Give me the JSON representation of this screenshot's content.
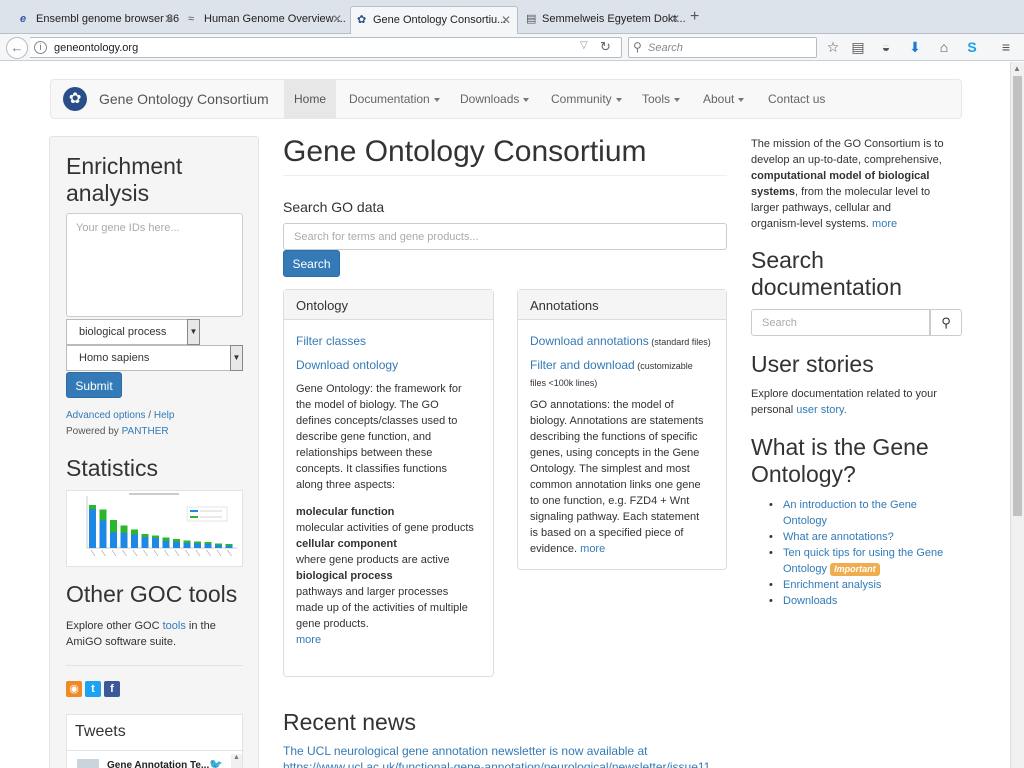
{
  "browser": {
    "tabs": [
      {
        "title": "Ensembl genome browser 86",
        "icon": "ensembl-icon"
      },
      {
        "title": "Human Genome Overview ...",
        "icon": "genome-icon"
      },
      {
        "title": "Gene Ontology Consortiu...",
        "icon": "go-icon",
        "active": true
      },
      {
        "title": "Semmelweis Egyetem Dokt...",
        "icon": "page-icon"
      }
    ],
    "url": "geneontology.org",
    "search_placeholder": "Search"
  },
  "site": {
    "brand": "Gene Ontology Consortium",
    "nav": [
      {
        "label": "Home",
        "active": true
      },
      {
        "label": "Documentation",
        "dropdown": true
      },
      {
        "label": "Downloads",
        "dropdown": true
      },
      {
        "label": "Community",
        "dropdown": true
      },
      {
        "label": "Tools",
        "dropdown": true
      },
      {
        "label": "About",
        "dropdown": true
      },
      {
        "label": "Contact us"
      }
    ]
  },
  "left": {
    "enrichment_title": "Enrichment analysis",
    "gene_ids_placeholder": "Your gene IDs here...",
    "process_select": "biological process",
    "species_select": "Homo sapiens",
    "submit": "Submit",
    "advanced": "Advanced options",
    "slash": " / ",
    "help": "Help",
    "powered_by": "Powered by ",
    "panther": "PANTHER",
    "statistics_title": "Statistics",
    "tools_title": "Other GOC tools",
    "tools_text_1": "Explore other GOC ",
    "tools_link": "tools",
    "tools_text_2": " in the",
    "tools_text_3": "AmiGO software suite.",
    "tweets_title": "Tweets",
    "tweet_author": "Gene Annotation Te..."
  },
  "stats_chart": {
    "bars": [
      {
        "blue": 0.78,
        "green": 0.08
      },
      {
        "blue": 0.55,
        "green": 0.22
      },
      {
        "blue": 0.32,
        "green": 0.24
      },
      {
        "blue": 0.3,
        "green": 0.15
      },
      {
        "blue": 0.27,
        "green": 0.1
      },
      {
        "blue": 0.22,
        "green": 0.06
      },
      {
        "blue": 0.2,
        "green": 0.05
      },
      {
        "blue": 0.14,
        "green": 0.07
      },
      {
        "blue": 0.12,
        "green": 0.06
      },
      {
        "blue": 0.1,
        "green": 0.05
      },
      {
        "blue": 0.09,
        "green": 0.04
      },
      {
        "blue": 0.08,
        "green": 0.04
      },
      {
        "blue": 0.06,
        "green": 0.03
      },
      {
        "blue": 0.05,
        "green": 0.03
      }
    ],
    "blue_color": "#1e88e5",
    "green_color": "#2bb62b"
  },
  "main": {
    "title": "Gene Ontology Consortium",
    "search_label": "Search GO data",
    "search_placeholder": "Search for terms and gene products...",
    "search_button": "Search",
    "ontology": {
      "heading": "Ontology",
      "link1": "Filter classes",
      "link2": "Download ontology",
      "para": [
        "Gene Ontology: the framework for",
        "the model of biology. The GO",
        "defines concepts/classes used to",
        "describe gene function, and",
        "relationships between these",
        "concepts. It classifies functions",
        "along three aspects:"
      ],
      "aspect1_title": "molecular function",
      "aspect1_text": "molecular activities of gene products",
      "aspect2_title": "cellular component",
      "aspect2_text": "where gene products are active",
      "aspect3_title": "biological process",
      "aspect3_text1": "pathways and larger processes",
      "aspect3_text2": "made up of the activities of multiple",
      "aspect3_text3": "gene products.",
      "more": "more"
    },
    "annotations": {
      "heading": "Annotations",
      "link1": "Download annotations",
      "link1_note": " (standard files)",
      "link2": "Filter and download",
      "link2_note": " (customizable",
      "link2_note2": "files <100k lines)",
      "para": [
        "GO annotations: the model of",
        "biology. Annotations are statements",
        "describing the functions of specific",
        "genes, using concepts in the Gene",
        "Ontology. The simplest and most",
        "common annotation links one gene",
        "to one function, e.g. FZD4 + Wnt",
        "signaling pathway. Each statement"
      ],
      "last_line": "is based on a specified piece of",
      "last_line2": "evidence. ",
      "more": "more"
    },
    "news_title": "Recent news",
    "news_line1": "The UCL neurological gene annotation newsletter is now available at",
    "news_line2": "https://www.ucl.ac.uk/functional-gene-annotation/neurological/newsletter/issue11"
  },
  "right": {
    "mission_1": "The mission of the GO Consortium is to",
    "mission_2": "develop an up-to-date, comprehensive,",
    "mission_bold1": "computational model of biological",
    "mission_bold2": "systems",
    "mission_3": ", from the molecular level to",
    "mission_4": "larger pathways, cellular and",
    "mission_5": "organism-level systems. ",
    "mission_more": "more",
    "search_doc_title1": "Search",
    "search_doc_title2": "documentation",
    "search_doc_placeholder": "Search",
    "stories_title": "User stories",
    "stories_text1": "Explore documentation related to your",
    "stories_text2": "personal ",
    "stories_link": "user story.",
    "what_title1": "What is the Gene",
    "what_title2": "Ontology?",
    "links": [
      {
        "text": "An introduction to the Gene",
        "text2": "Ontology"
      },
      {
        "text": "What are annotations?"
      },
      {
        "text": "Ten quick tips for using the Gene",
        "text2": "Ontology",
        "badge": "Important"
      },
      {
        "text": "Enrichment analysis"
      },
      {
        "text": "Downloads"
      }
    ]
  }
}
